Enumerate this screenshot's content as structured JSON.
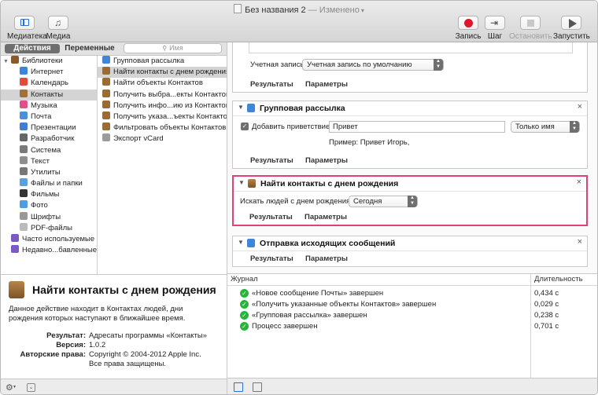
{
  "window": {
    "title": "Без названия 2",
    "edited": "— Изменено"
  },
  "toolbar": {
    "library": "Медиатека",
    "media": "Медиа",
    "record": "Запись",
    "step": "Шаг",
    "stop": "Остановить",
    "run": "Запустить"
  },
  "tabs": {
    "actions": "Действия",
    "variables": "Переменные"
  },
  "search": {
    "placeholder": "Имя"
  },
  "categories": [
    {
      "label": "Библиотеки",
      "color": "#8a5a2b",
      "icon": "library-icon"
    },
    {
      "label": "Интернет",
      "color": "#3a86d8",
      "icon": "internet-icon"
    },
    {
      "label": "Календарь",
      "color": "#e24a3b",
      "icon": "calendar-icon"
    },
    {
      "label": "Контакты",
      "color": "#a0703a",
      "icon": "contacts-icon"
    },
    {
      "label": "Музыка",
      "color": "#e0508a",
      "icon": "music-icon"
    },
    {
      "label": "Почта",
      "color": "#4a8fe0",
      "icon": "mail-icon"
    },
    {
      "label": "Презентации",
      "color": "#3f7fd0",
      "icon": "presentation-icon"
    },
    {
      "label": "Разработчик",
      "color": "#666666",
      "icon": "developer-icon"
    },
    {
      "label": "Система",
      "color": "#7a7a7a",
      "icon": "system-icon"
    },
    {
      "label": "Текст",
      "color": "#8f8f8f",
      "icon": "text-icon"
    },
    {
      "label": "Утилиты",
      "color": "#777777",
      "icon": "utilities-icon"
    },
    {
      "label": "Файлы и папки",
      "color": "#5aa0e0",
      "icon": "folder-icon"
    },
    {
      "label": "Фильмы",
      "color": "#333333",
      "icon": "movies-icon"
    },
    {
      "label": "Фото",
      "color": "#4c9ee0",
      "icon": "photo-icon"
    },
    {
      "label": "Шрифты",
      "color": "#999999",
      "icon": "fonts-icon"
    },
    {
      "label": "PDF-файлы",
      "color": "#bbbbbb",
      "icon": "pdf-icon"
    },
    {
      "label": "Часто используемые",
      "color": "#7b5ac8",
      "icon": "smart-folder-icon"
    },
    {
      "label": "Недавно...бавленные",
      "color": "#7b5ac8",
      "icon": "smart-folder-icon"
    }
  ],
  "actions": [
    "Групповая рассылка",
    "Найти контакты с днем рождения",
    "Найти объекты Контактов",
    "Получить выбра...екты Контактов",
    "Получить инфо...ию из Контактов",
    "Получить указа...ъекты Контактов",
    "Фильтровать объекты Контактов",
    "Экспорт vCard"
  ],
  "info": {
    "title": "Найти контакты с днем рождения",
    "description": "Данное действие находит в Контактах людей, дни рождения которых наступают в ближайшее время.",
    "result_label": "Результат:",
    "result": "Адресаты программы «Контакты»",
    "version_label": "Версия:",
    "version": "1.0.2",
    "copyright_label": "Авторские права:",
    "copyright": "Copyright © 2004-2012 Apple Inc. Все права защищены."
  },
  "workflow": {
    "account_label": "Учетная запись:",
    "account_value": "Учетная запись по умолчанию",
    "results": "Результаты",
    "params": "Параметры",
    "mass": {
      "title": "Групповая рассылка",
      "greeting_label": "Добавить приветствие",
      "greeting_value": "Привет",
      "name_option": "Только имя",
      "example": "Пример:  Привет Игорь,"
    },
    "bday": {
      "title": "Найти контакты с днем рождения",
      "find_label": "Искать людей с днем рождения",
      "find_value": "Сегодня"
    },
    "send": {
      "title": "Отправка исходящих сообщений"
    }
  },
  "log": {
    "col_journal": "Журнал",
    "col_duration": "Длительность",
    "rows": [
      {
        "message": "«Новое сообщение Почты» завершен",
        "duration": "0,434 с"
      },
      {
        "message": "«Получить указанные объекты Контактов» завершен",
        "duration": "0,029 с"
      },
      {
        "message": "«Групповая рассылка» завершен",
        "duration": "0,238 с"
      },
      {
        "message": "Процесс завершен",
        "duration": "0,701 с"
      }
    ]
  }
}
